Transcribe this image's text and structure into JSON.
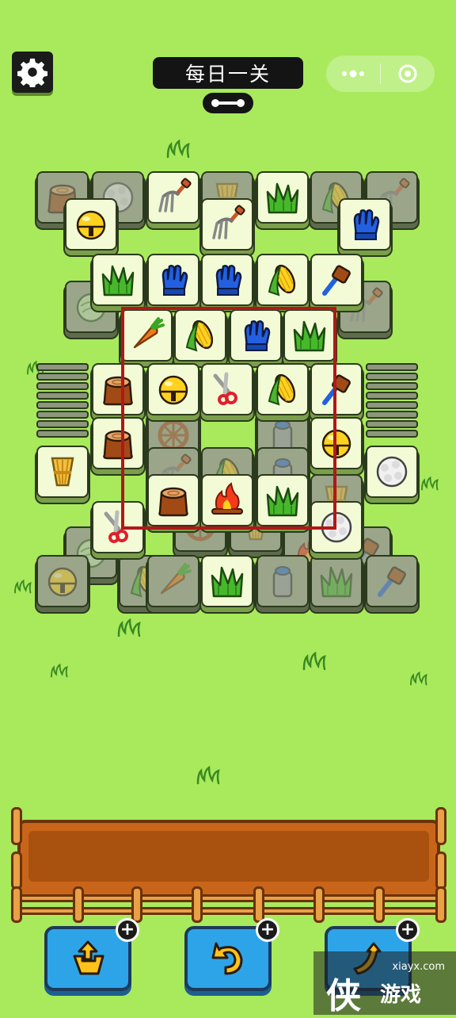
{
  "header": {
    "title": "每日一关",
    "settings_icon": "gear-icon",
    "menu_icon": "more-dots-icon",
    "close_icon": "target-circle-icon"
  },
  "board": {
    "highlight_color": "#b01818",
    "tile_face_color": "#f3fbd6",
    "tile_names": [
      "stump",
      "bell",
      "wool",
      "fork",
      "gloves",
      "hay",
      "grass",
      "corn",
      "wheel",
      "shears",
      "fire",
      "bucket",
      "cabbage",
      "carrot",
      "brush"
    ]
  },
  "tray": {
    "slot_count": 7,
    "color": "#c9651a"
  },
  "tools": [
    {
      "name": "remove-tool",
      "icon": "box-arrow-up-icon",
      "badge": "+"
    },
    {
      "name": "undo-tool",
      "icon": "undo-arrow-icon",
      "badge": "+"
    },
    {
      "name": "shuffle-tool",
      "icon": "shuffle-icon",
      "badge": "+"
    }
  ],
  "watermark": {
    "logo": "侠",
    "text": "游戏",
    "url": "xiayx.com"
  }
}
